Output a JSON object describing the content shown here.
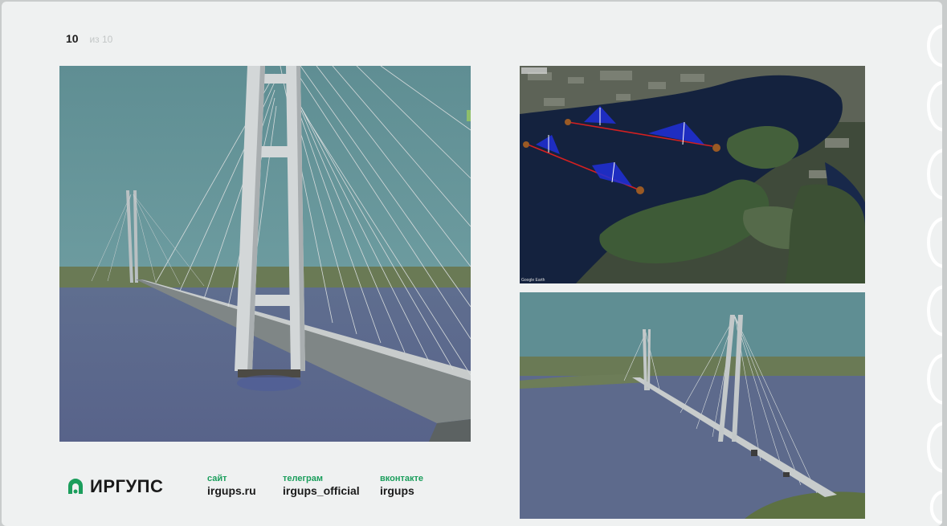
{
  "pager": {
    "current": "10",
    "total": "из 10"
  },
  "brand": {
    "name": "ИРГУПС",
    "logo_icon": "irgups-logo-icon",
    "accent_color": "#1b9e5c"
  },
  "contacts": [
    {
      "label": "сайт",
      "value": "irgups.ru"
    },
    {
      "label": "телеграм",
      "value": "irgups_official"
    },
    {
      "label": "вконтакте",
      "value": "irgups"
    }
  ],
  "images": {
    "main": "cable-stayed-bridge-render-main",
    "map": "bridge-route-satellite-map",
    "side": "cable-stayed-bridge-render-side"
  },
  "map": {
    "caption": "Google Earth"
  }
}
